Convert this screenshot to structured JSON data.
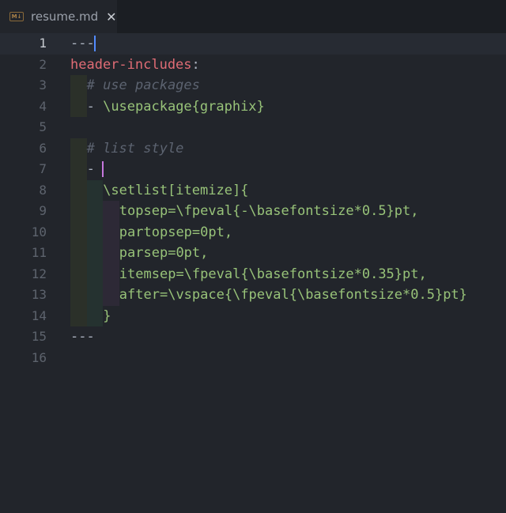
{
  "tab": {
    "icon": "markdown-icon",
    "title": "resume.md",
    "close": "✕"
  },
  "lines": [
    {
      "n": "1",
      "text": "---"
    },
    {
      "n": "2",
      "key": "header-includes",
      "colon": ":"
    },
    {
      "n": "3",
      "text": "# use packages"
    },
    {
      "n": "4",
      "dash": "- ",
      "text": "\\usepackage{graphix}"
    },
    {
      "n": "5",
      "text": ""
    },
    {
      "n": "6",
      "text": "# list style"
    },
    {
      "n": "7",
      "dash": "- "
    },
    {
      "n": "8",
      "text": "\\setlist[itemize]{"
    },
    {
      "n": "9",
      "text": "topsep=\\fpeval{-\\basefontsize*0.5}pt,"
    },
    {
      "n": "10",
      "text": "partopsep=0pt,"
    },
    {
      "n": "11",
      "text": "parsep=0pt,"
    },
    {
      "n": "12",
      "text": "itemsep=\\fpeval{\\basefontsize*0.35}pt,"
    },
    {
      "n": "13",
      "text": "after=\\vspace{\\fpeval{\\basefontsize*0.5}pt}"
    },
    {
      "n": "14",
      "text": "}"
    },
    {
      "n": "15",
      "text": "---"
    },
    {
      "n": "16",
      "text": ""
    }
  ],
  "colors": {
    "string": "#98c379",
    "key": "#e06c75",
    "comment": "#5c6370",
    "cursor_line1": "#528bff",
    "cursor_line7": "#c678dd"
  }
}
